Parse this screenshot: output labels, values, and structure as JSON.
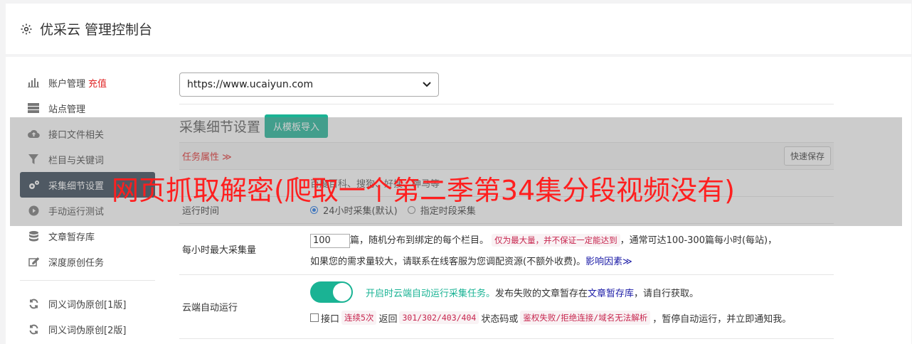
{
  "header": {
    "icon": "gear-icon",
    "title": "优采云 管理控制台"
  },
  "sidebar": {
    "items": [
      {
        "icon": "bar-chart-icon",
        "label": "账户管理",
        "badge": "充值",
        "active": false
      },
      {
        "icon": "server-icon",
        "label": "站点管理",
        "badge": "",
        "active": false
      },
      {
        "icon": "cloud-upload-icon",
        "label": "接口文件相关",
        "badge": "",
        "active": false
      },
      {
        "icon": "filter-icon",
        "label": "栏目与关键词",
        "badge": "",
        "active": false
      },
      {
        "icon": "cogs-icon",
        "label": "采集细节设置",
        "badge": "",
        "active": true
      },
      {
        "icon": "play-circle-icon",
        "label": "手动运行测试",
        "badge": "",
        "active": false
      },
      {
        "icon": "database-icon",
        "label": "文章暂存库",
        "badge": "",
        "active": false
      },
      {
        "icon": "edit-icon",
        "label": "深度原创任务",
        "badge": "",
        "active": false
      }
    ],
    "tools": [
      {
        "icon": "refresh-icon",
        "label": "同义词伪原创[1版]"
      },
      {
        "icon": "refresh-icon",
        "label": "同义词伪原创[2版]"
      }
    ]
  },
  "main": {
    "site_select": "https://www.ucaiyun.com",
    "section_title": "采集细节设置",
    "import_button": "从模板导入",
    "task_attr": "任务属性 ≫",
    "quick_save": "快速保存",
    "sites_row_text": "百度百科、搜狗、好搜、神马等",
    "run_time": {
      "label": "运行时间",
      "option1": "24小时采集(默认)",
      "option2": "指定时段采集"
    },
    "max_per_hour": {
      "label": "每小时最大采集量",
      "value": "100",
      "text1": "篇，随机分布到绑定的每个栏目。",
      "tag": "仅为最大量，并不保证一定能达到",
      "text2": "，通常可达100-300篇每小时(每站)，",
      "text3": "如果您的需求量较大，请联系在线客服为您调配资源(不额外收费)。",
      "link": "影响因素≫"
    },
    "auto_run": {
      "label": "云端自动运行",
      "toggle_text": "开启时云端自动运行采集任务。",
      "desc1": "发布失败的文章暂存在",
      "desc_link": "文章暂存库",
      "desc2": "，请自行获取。",
      "cb_label": "接口",
      "tag1": "连续5次",
      "text_back": "返回",
      "tag2": "301/302/403/404",
      "text_status": "状态码或",
      "tag3": "鉴权失败/拒绝连接/域名无法解析",
      "text_end": "，暂停自动运行，并立即通知我。"
    }
  },
  "watermark": "网页抓取解密(爬取一个第二季第34集分段视频没有)",
  "colors": {
    "accent": "#1ab394",
    "sidebar_active": "#2f4050",
    "danger": "#e02424"
  }
}
